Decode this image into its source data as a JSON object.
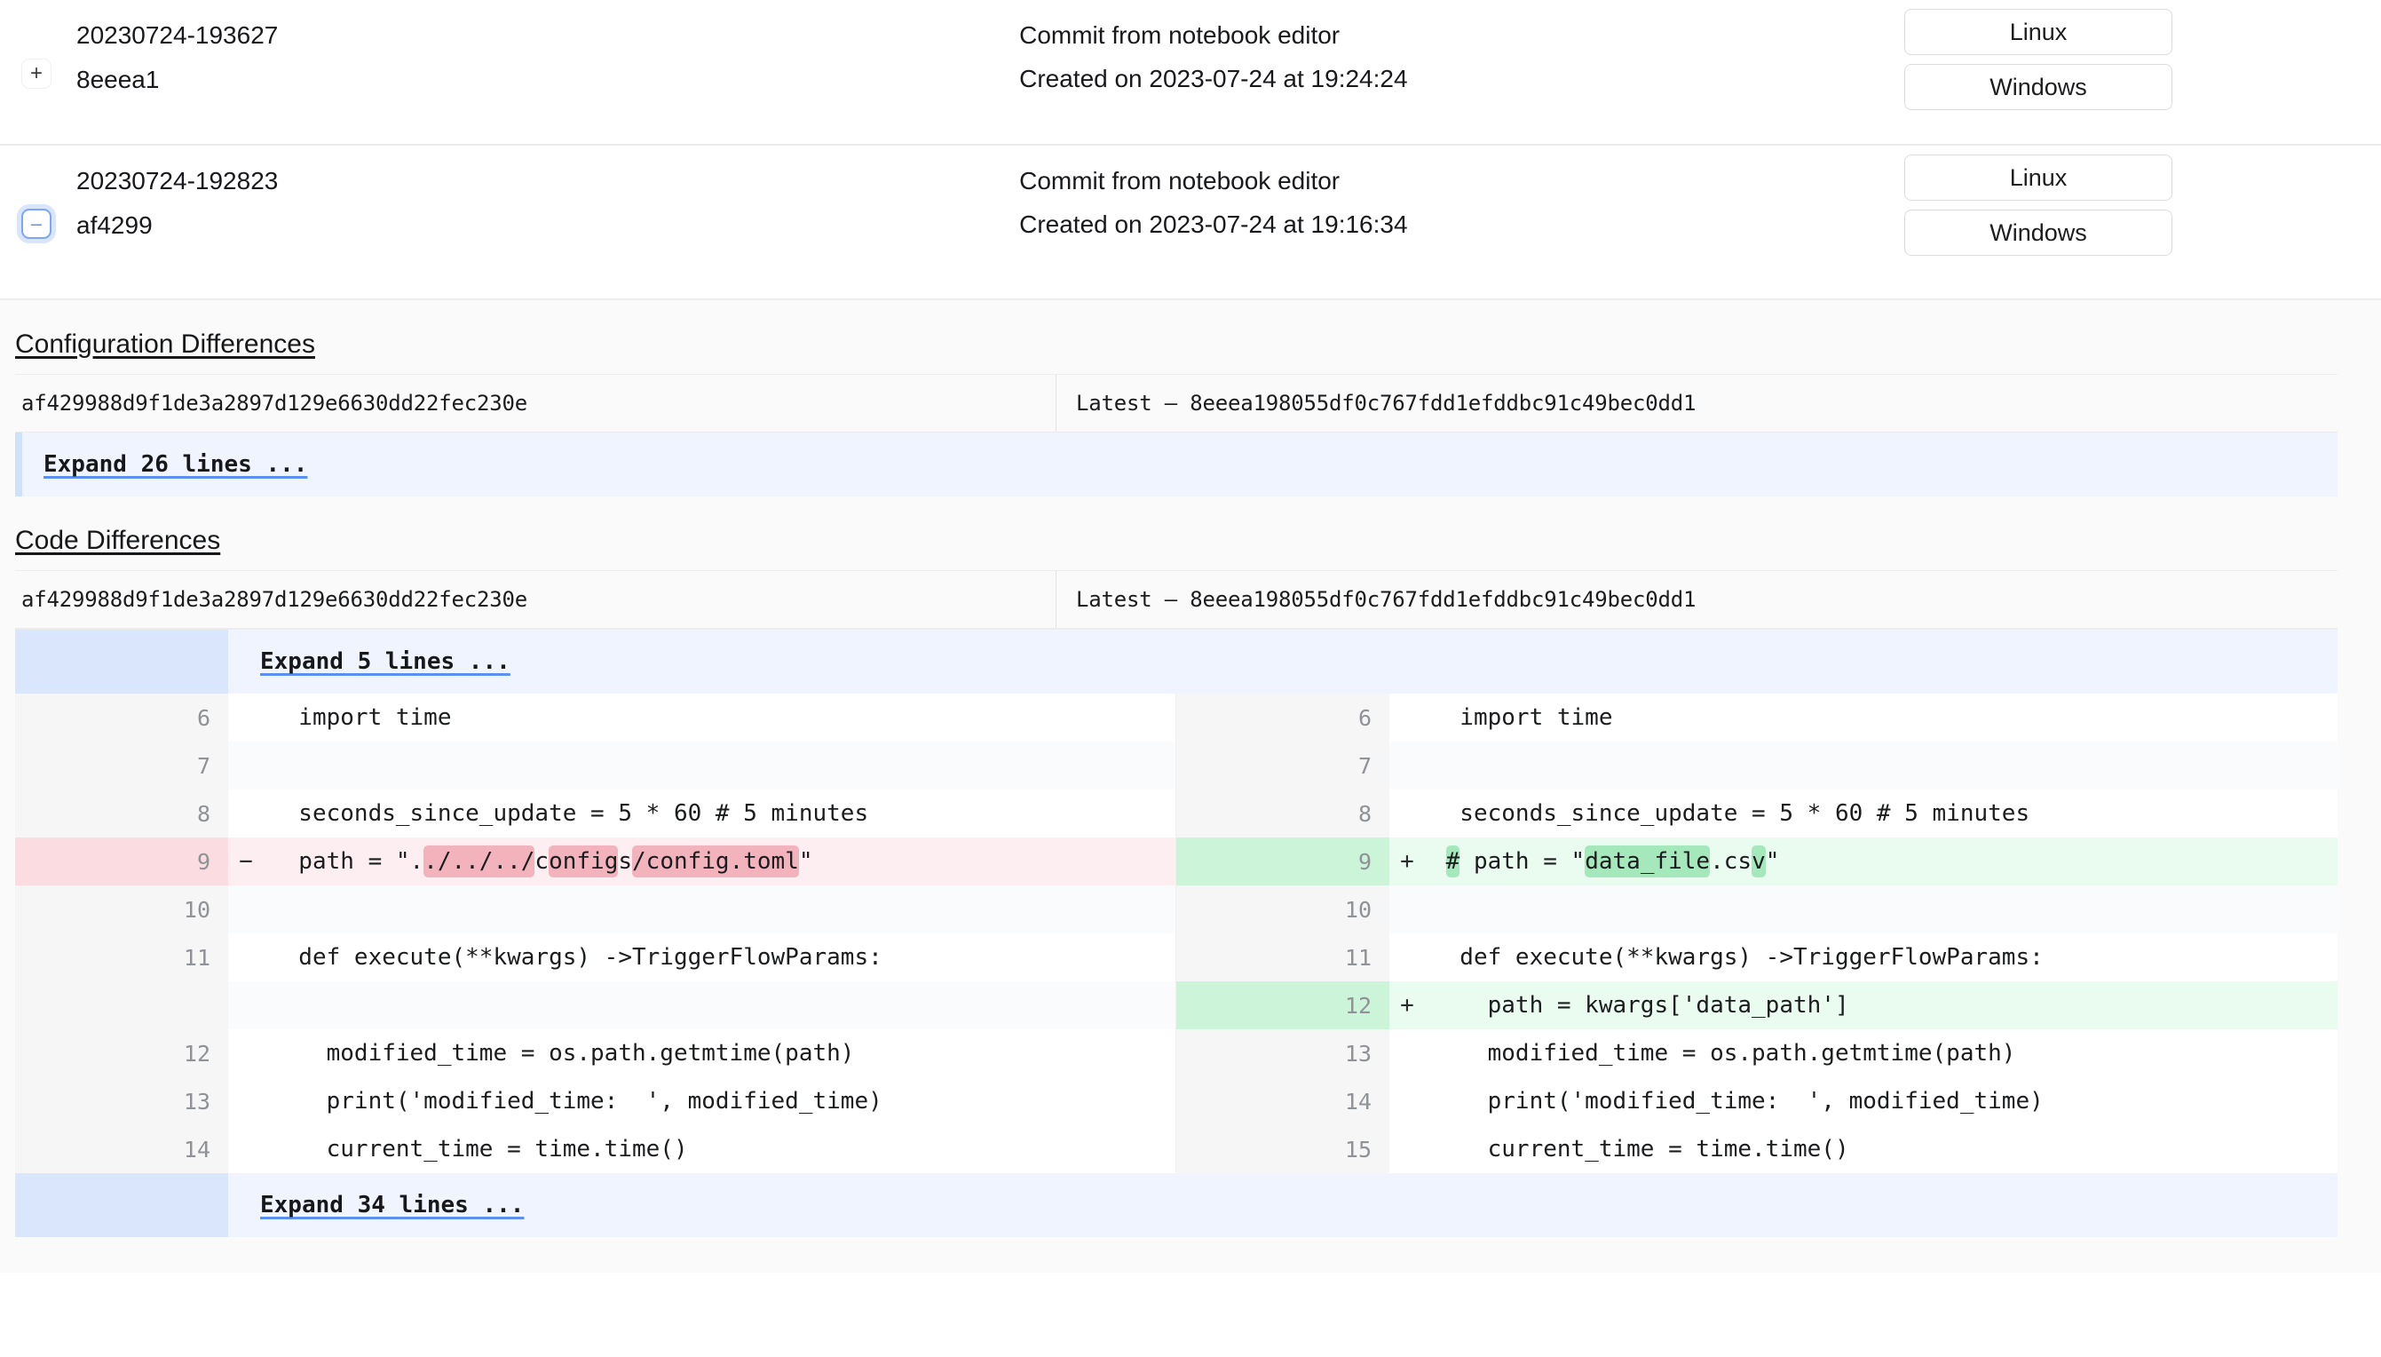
{
  "commits": [
    {
      "toggle_icon": "plus-icon",
      "toggle_symbol": "+",
      "name": "20230724-193627",
      "short_hash": "8eeea1",
      "message": "Commit from notebook editor",
      "created": "Created on 2023-07-24 at 19:24:24",
      "buttons": [
        "Linux",
        "Windows"
      ]
    },
    {
      "toggle_icon": "minus-icon",
      "toggle_symbol": "–",
      "name": "20230724-192823",
      "short_hash": "af4299",
      "message": "Commit from notebook editor",
      "created": "Created on 2023-07-24 at 19:16:34",
      "buttons": [
        "Linux",
        "Windows"
      ]
    }
  ],
  "config_diff": {
    "title": "Configuration Differences",
    "left_hash": "af429988d9f1de3a2897d129e6630dd22fec230e",
    "right_hash": "Latest – 8eeea198055df0c767fdd1efddbc91c49bec0dd1",
    "expand_label": "Expand 26 lines ..."
  },
  "code_diff": {
    "title": "Code Differences",
    "left_hash": "af429988d9f1de3a2897d129e6630dd22fec230e",
    "right_hash": "Latest – 8eeea198055df0c767fdd1efddbc91c49bec0dd1",
    "expand_top_label": "Expand 5 lines ...",
    "expand_bottom_label": "Expand 34 lines ...",
    "rows": [
      {
        "type": "plain",
        "left": {
          "num": "6",
          "marker": "",
          "segments": [
            {
              "t": "  import time",
              "h": "none"
            }
          ]
        },
        "right": {
          "num": "6",
          "marker": "",
          "segments": [
            {
              "t": "  import time",
              "h": "none"
            }
          ]
        }
      },
      {
        "type": "alt",
        "left": {
          "num": "7",
          "marker": "",
          "segments": [
            {
              "t": "",
              "h": "none"
            }
          ]
        },
        "right": {
          "num": "7",
          "marker": "",
          "segments": [
            {
              "t": "",
              "h": "none"
            }
          ]
        }
      },
      {
        "type": "plain",
        "left": {
          "num": "8",
          "marker": "",
          "segments": [
            {
              "t": "  seconds_since_update = 5 * 60 # 5 minutes",
              "h": "none"
            }
          ]
        },
        "right": {
          "num": "8",
          "marker": "",
          "segments": [
            {
              "t": "  seconds_since_update = 5 * 60 # 5 minutes",
              "h": "none"
            }
          ]
        }
      },
      {
        "type": "change",
        "left": {
          "num": "9",
          "marker": "−",
          "kind": "del",
          "segments": [
            {
              "t": "  path = \".",
              "h": "none"
            },
            {
              "t": "./../../",
              "h": "del"
            },
            {
              "t": "c",
              "h": "none"
            },
            {
              "t": "onfig",
              "h": "del"
            },
            {
              "t": "s",
              "h": "none"
            },
            {
              "t": "/config.toml",
              "h": "del"
            },
            {
              "t": "\"",
              "h": "none"
            }
          ]
        },
        "right": {
          "num": "9",
          "marker": "+",
          "kind": "add",
          "segments": [
            {
              "t": " ",
              "h": "none"
            },
            {
              "t": "#",
              "h": "add"
            },
            {
              "t": " path = \"",
              "h": "none"
            },
            {
              "t": "data_file",
              "h": "add"
            },
            {
              "t": ".",
              "h": "none"
            },
            {
              "t": "c",
              "h": "none"
            },
            {
              "t": "s",
              "h": "none"
            },
            {
              "t": "v",
              "h": "add"
            },
            {
              "t": "\"",
              "h": "none"
            }
          ]
        }
      },
      {
        "type": "alt",
        "left": {
          "num": "10",
          "marker": "",
          "segments": [
            {
              "t": "",
              "h": "none"
            }
          ]
        },
        "right": {
          "num": "10",
          "marker": "",
          "segments": [
            {
              "t": "",
              "h": "none"
            }
          ]
        }
      },
      {
        "type": "plain",
        "left": {
          "num": "11",
          "marker": "",
          "segments": [
            {
              "t": "  def execute(**kwargs) ->TriggerFlowParams:",
              "h": "none"
            }
          ]
        },
        "right": {
          "num": "11",
          "marker": "",
          "segments": [
            {
              "t": "  def execute(**kwargs) ->TriggerFlowParams:",
              "h": "none"
            }
          ]
        }
      },
      {
        "type": "insert",
        "left": {
          "num": "",
          "marker": "",
          "kind": "empty",
          "segments": [
            {
              "t": "",
              "h": "none"
            }
          ]
        },
        "right": {
          "num": "12",
          "marker": "+",
          "kind": "add",
          "segments": [
            {
              "t": "    path = kwargs['data_path']",
              "h": "none"
            }
          ]
        }
      },
      {
        "type": "plain",
        "left": {
          "num": "12",
          "marker": "",
          "segments": [
            {
              "t": "    modified_time = os.path.getmtime(path)",
              "h": "none"
            }
          ]
        },
        "right": {
          "num": "13",
          "marker": "",
          "segments": [
            {
              "t": "    modified_time = os.path.getmtime(path)",
              "h": "none"
            }
          ]
        }
      },
      {
        "type": "plain",
        "left": {
          "num": "13",
          "marker": "",
          "segments": [
            {
              "t": "    print('modified_time:  ', modified_time)",
              "h": "none"
            }
          ]
        },
        "right": {
          "num": "14",
          "marker": "",
          "segments": [
            {
              "t": "    print('modified_time:  ', modified_time)",
              "h": "none"
            }
          ]
        }
      },
      {
        "type": "plain",
        "left": {
          "num": "14",
          "marker": "",
          "segments": [
            {
              "t": "    current_time = time.time()",
              "h": "none"
            }
          ]
        },
        "right": {
          "num": "15",
          "marker": "",
          "segments": [
            {
              "t": "    current_time = time.time()",
              "h": "none"
            }
          ]
        }
      }
    ]
  },
  "colors": {
    "add_bg": "#eafbf0",
    "add_gutter": "#ccf4d8",
    "add_word": "#a5e8bb",
    "del_bg": "#fdeff1",
    "del_gutter": "#fbdde1",
    "del_word": "#f2b3bd",
    "expand_bg": "#eff4fe",
    "expand_gutter": "#d9e6fb",
    "link": "#5b8ff0"
  }
}
